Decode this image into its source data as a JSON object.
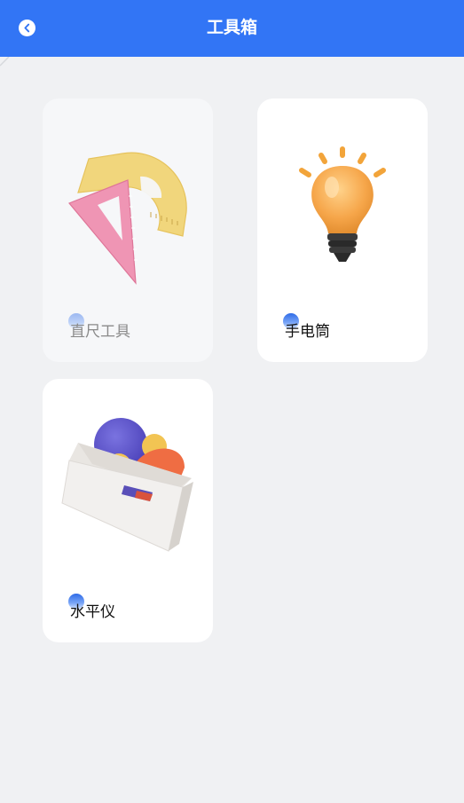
{
  "header": {
    "title": "工具箱",
    "back_icon": "chevron-left-icon",
    "background_color": "#3275f5"
  },
  "tools": [
    {
      "label": "直尺工具",
      "icon": "ruler-protractor-illustration",
      "state": "disabled"
    },
    {
      "label": "手电筒",
      "icon": "lightbulb-illustration",
      "state": "enabled"
    },
    {
      "label": "水平仪",
      "icon": "toolbox-illustration",
      "state": "enabled"
    }
  ]
}
